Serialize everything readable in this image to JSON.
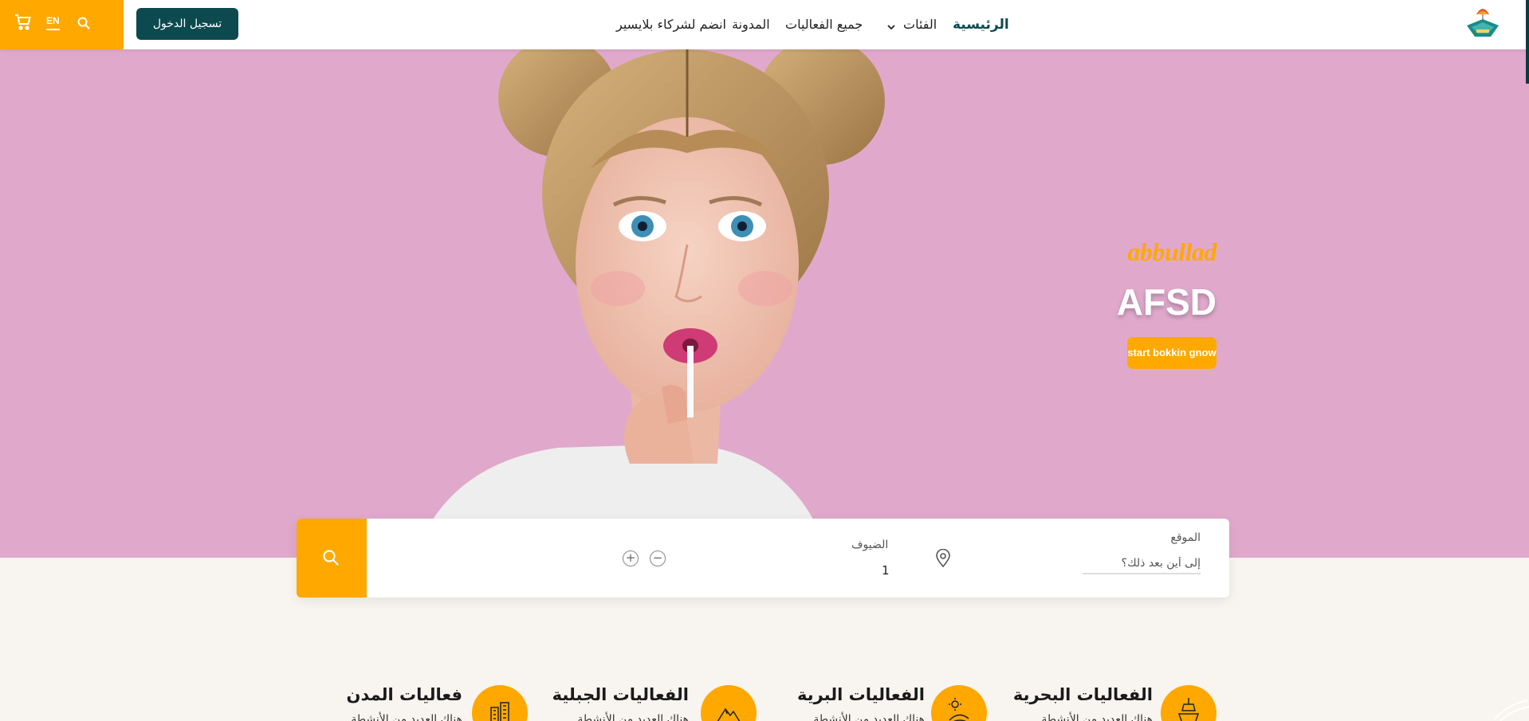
{
  "header": {
    "lang_toggle": "EN",
    "login_label": "تسجيل الدخول",
    "nav": {
      "home": "الرئيسية",
      "categories": "الفئات",
      "all_events": "جميع الفعاليات",
      "blog": "المدونة",
      "join_partners": "انضم لشركاء بلايسير"
    },
    "icons": [
      "cart-icon",
      "search-icon",
      "chevron-down-icon",
      "logo"
    ]
  },
  "hero": {
    "subtitle": "abbullad",
    "title": "AFSD",
    "cta_label": "start bokkin gnow"
  },
  "search": {
    "location_label": "الموقع",
    "location_placeholder": "إلى أين بعد ذلك؟",
    "guests_label": "الضيوف",
    "guests_value": "1",
    "minus": "−",
    "plus": "+"
  },
  "categories": [
    {
      "title": "الفعاليات البحرية",
      "desc": "هناك العديد من الأنشطة",
      "icon": "ship-icon"
    },
    {
      "title": "الفعاليات البرية",
      "desc": "هناك العديد من الأنشطة",
      "icon": "desert-icon"
    },
    {
      "title": "الفعاليات الجبلية",
      "desc": "هناك العديد من الأنشطة",
      "icon": "mountain-icon"
    },
    {
      "title": "فعاليات المدن",
      "desc": "هناك العديد من الأنشطة",
      "icon": "city-icon"
    }
  ],
  "colors": {
    "accent": "#ffa800",
    "primary": "#0c4a4f",
    "hero_bg": "#e0a9cc",
    "page_bg": "#f8f4ef"
  }
}
